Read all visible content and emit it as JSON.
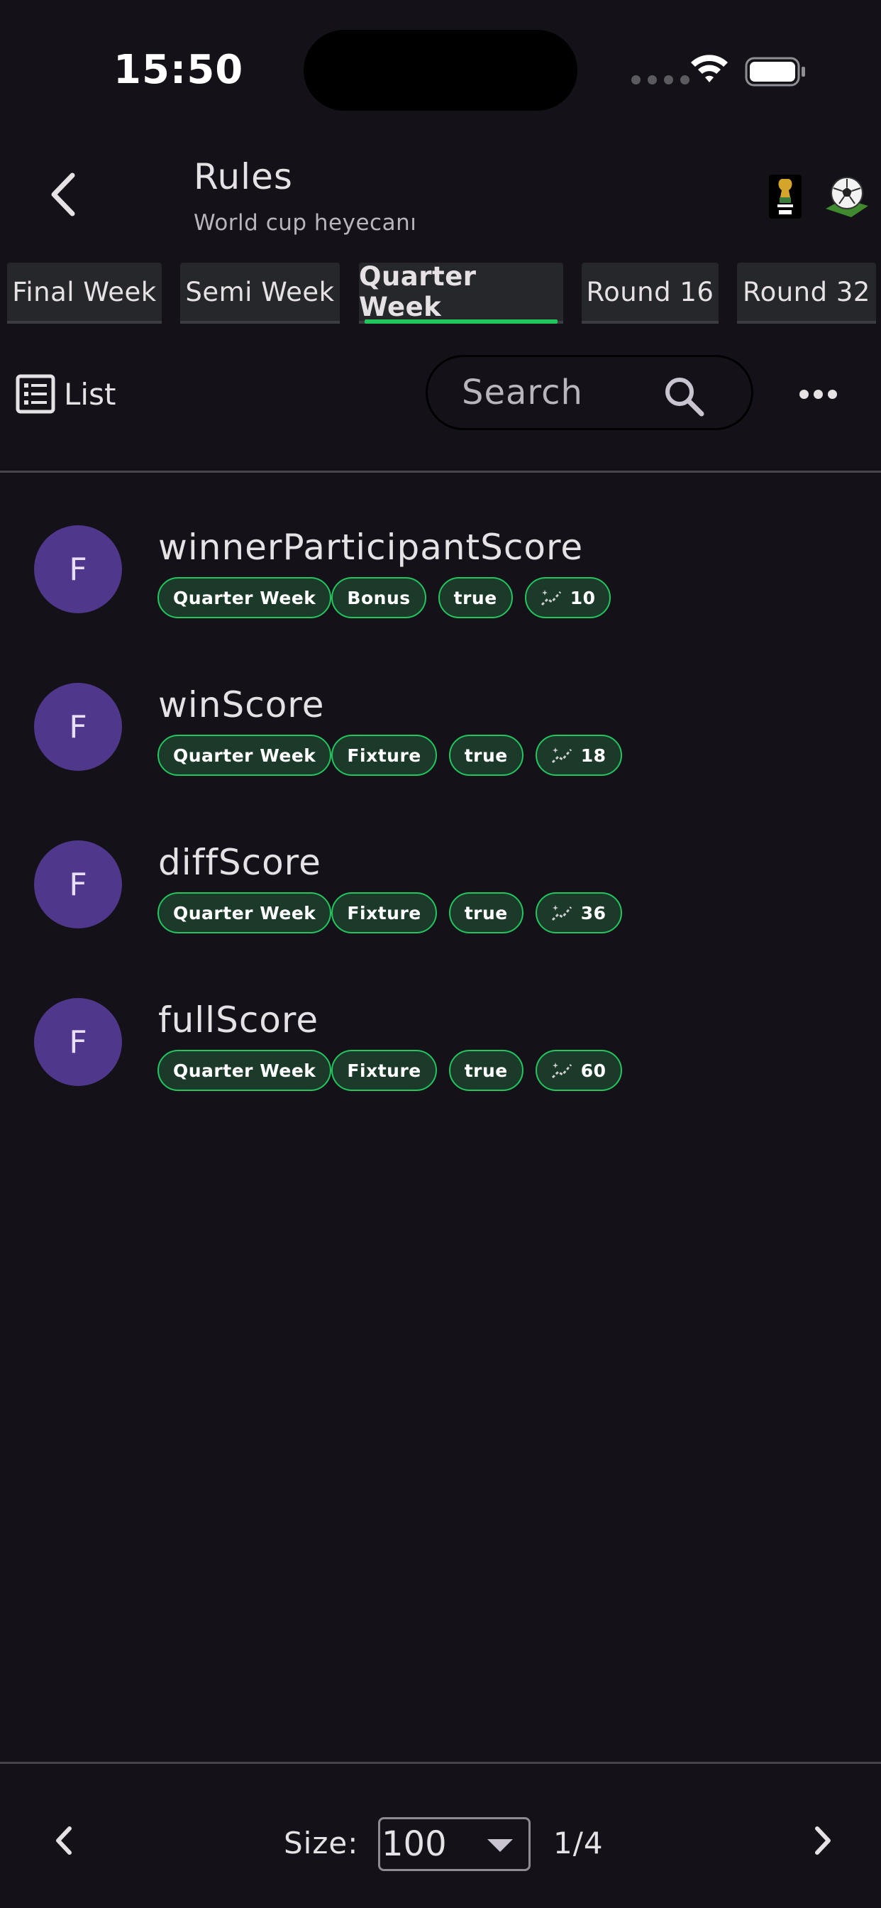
{
  "status_bar": {
    "time": "15:50"
  },
  "header": {
    "title": "Rules",
    "subtitle": "World cup heyecanı"
  },
  "tabs": [
    {
      "label": "Final Week"
    },
    {
      "label": "Semi Week"
    },
    {
      "label": "Quarter Week",
      "selected": true
    },
    {
      "label": "Round 16"
    },
    {
      "label": "Round 32"
    }
  ],
  "toolbar": {
    "view_label": "List",
    "search_placeholder": "Search"
  },
  "rules": [
    {
      "avatar": "F",
      "name": "winnerParticipantScore",
      "week": "Quarter Week",
      "type": "Bonus",
      "active": "true",
      "points": "10"
    },
    {
      "avatar": "F",
      "name": "winScore",
      "week": "Quarter Week",
      "type": "Fixture",
      "active": "true",
      "points": "18"
    },
    {
      "avatar": "F",
      "name": "diffScore",
      "week": "Quarter Week",
      "type": "Fixture",
      "active": "true",
      "points": "36"
    },
    {
      "avatar": "F",
      "name": "fullScore",
      "week": "Quarter Week",
      "type": "Fixture",
      "active": "true",
      "points": "60"
    }
  ],
  "pagination": {
    "size_label": "Size:",
    "size_value": "100",
    "page": "1/4"
  },
  "colors": {
    "accent": "#22c55e",
    "avatar": "#4f378b",
    "background": "#141218"
  }
}
